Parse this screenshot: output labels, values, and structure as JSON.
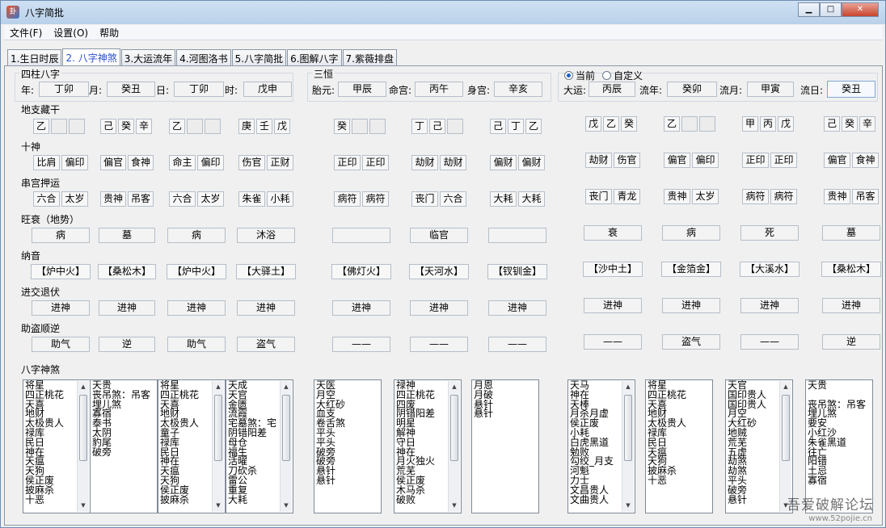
{
  "window": {
    "title": "八字简批",
    "min": "▁",
    "max": "□",
    "close": "✕"
  },
  "menu": [
    "文件(F)",
    "设置(O)",
    "帮助"
  ],
  "tabs": [
    "1.生日时辰",
    "2. 八字神煞",
    "3.大运流年",
    "4.河图洛书",
    "5.八字简批",
    "6.图解八字",
    "7.紫薇排盘"
  ],
  "bazi": {
    "title": "四柱八字",
    "year_label": "年:",
    "year": "丁卯",
    "month_label": "月:",
    "month": "癸丑",
    "day_label": "日:",
    "day": "丁卯",
    "hour_label": "时:",
    "hour": "戊申"
  },
  "sanyuan": {
    "title": "三恒",
    "taiyuan_label": "胎元:",
    "taiyuan": "甲辰",
    "minggong_label": "命宫:",
    "minggong": "丙午",
    "shengong_label": "身宫:",
    "shengong": "辛亥"
  },
  "current": {
    "opt_current": "当前",
    "opt_custom": "自定义",
    "dayun_label": "大运:",
    "dayun": "丙辰",
    "liunian_label": "流年:",
    "liunian": "癸卯",
    "liuyue_label": "流月:",
    "liuyue": "甲寅",
    "liuri_label": "流日:",
    "liuri": "癸丑"
  },
  "sections": {
    "dizhi": "地支藏干",
    "shishen": "十神",
    "chuangong": "串宫押运",
    "wangshuai": "旺衰（地势）",
    "nayin": "纳音",
    "jinjiao": "进交退伏",
    "zhudao": "助盗顺逆",
    "shensha": "八字神煞"
  },
  "columns": [
    {
      "canggan": [
        "乙",
        "",
        ""
      ],
      "shishen": [
        "比肩",
        "偏印"
      ],
      "chuan": [
        "六合",
        "太岁"
      ],
      "ws": "病",
      "nayin": "【炉中火】",
      "jj": "进神",
      "zd": "助气",
      "shensha": "将星\n四正桃花\n天喜\n地财\n太极贵人\n禄库\n民日\n神在\n天瘟\n天狗\n侯正废\n披麻杀\n十恶"
    },
    {
      "canggan": [
        "己",
        "癸",
        "辛"
      ],
      "shishen": [
        "偏官",
        "食神"
      ],
      "chuan": [
        "贵神",
        "吊客"
      ],
      "ws": "墓",
      "nayin": "【桑松木】",
      "jj": "进神",
      "zd": "逆",
      "shensha": "天贵\n丧吊煞：吊客\n埋儿煞\n寡宿\n泰书\n太阴\n豹尾\n破旁"
    },
    {
      "canggan": [
        "乙",
        "",
        ""
      ],
      "shishen": [
        "命主",
        "偏印"
      ],
      "chuan": [
        "六合",
        "太岁"
      ],
      "ws": "病",
      "nayin": "【炉中火】",
      "jj": "进神",
      "zd": "助气",
      "shensha": "将星\n四正桃花\n天喜\n地财\n太极贵人\n童子\n禄库\n民日\n神在\n天瘟\n天狗\n侯正废\n披麻杀"
    },
    {
      "canggan": [
        "庚",
        "壬",
        "戊"
      ],
      "shishen": [
        "伤官",
        "正财"
      ],
      "chuan": [
        "朱雀",
        "小耗"
      ],
      "ws": "沐浴",
      "nayin": "【大驿土】",
      "jj": "进神",
      "zd": "盗气",
      "shensha": "天成\n天官\n金匮\n流霞\n宅墓煞：宅\n阴错阳差\n母仓\n福生\n活曜\n刀砍杀\n雷公\n重复\n大耗"
    },
    {
      "canggan": [
        "癸",
        "",
        ""
      ],
      "shishen": [
        "正印",
        "正印"
      ],
      "chuan": [
        "病符",
        "病符"
      ],
      "ws": "",
      "nayin": "【佛灯火】",
      "jj": "进神",
      "zd": "——",
      "shensha": "天医\n月空\n大红砂\n血支\n卷舌煞\n平头\n平头\n破旁\n破旁\n悬针\n悬针"
    },
    {
      "canggan": [
        "丁",
        "己",
        ""
      ],
      "shishen": [
        "劫财",
        "劫财"
      ],
      "chuan": [
        "丧门",
        "六合"
      ],
      "ws": "临官",
      "nayin": "【天河水】",
      "jj": "进神",
      "zd": "——",
      "shensha": "禄神\n四正桃花\n四废\n阴错阳差\n明星\n解神\n守日\n神在\n月火独火\n荒芜\n侯正废\n木马杀\n破败"
    },
    {
      "canggan": [
        "己",
        "丁",
        "乙"
      ],
      "shishen": [
        "偏财",
        "偏财"
      ],
      "chuan": [
        "大耗",
        "大耗"
      ],
      "ws": "",
      "nayin": "【钗钏金】",
      "jj": "进神",
      "zd": "——",
      "shensha": "月恩\n月破\n悬针\n悬针"
    },
    {
      "canggan": [
        "戊",
        "乙",
        "癸"
      ],
      "shishen": [
        "劫财",
        "伤官"
      ],
      "chuan": [
        "丧门",
        "青龙"
      ],
      "ws": "衰",
      "nayin": "【沙中土】",
      "jj": "进神",
      "zd": "——",
      "shensha": "天马\n神在\n天棒\n月杀月虚\n侯正废\n小耗\n白虎黑道\n勉败\n勾绞_月支\n河魁\n力士\n文昌贵人\n文曲贵人"
    },
    {
      "canggan": [
        "乙",
        "",
        ""
      ],
      "shishen": [
        "偏官",
        "偏印"
      ],
      "chuan": [
        "贵神",
        "太岁"
      ],
      "ws": "病",
      "nayin": "【金箔金】",
      "jj": "进神",
      "zd": "盗气",
      "shensha": "将星\n四正桃花\n天喜\n地财\n太极贵人\n禄库\n民日\n天瘟\n天狗\n披麻杀\n十恶"
    },
    {
      "canggan": [
        "甲",
        "丙",
        "戊"
      ],
      "shishen": [
        "正印",
        "正印"
      ],
      "chuan": [
        "病符",
        "病符"
      ],
      "ws": "死",
      "nayin": "【大溪水】",
      "jj": "进神",
      "zd": "——",
      "shensha": "天官\n国印贵人\n国印贵人\n月空\n大红砂\n地贼\n荒芜\n五虚\n劫煞\n劫煞\n平头\n破旁\n悬针"
    },
    {
      "canggan": [
        "己",
        "癸",
        "辛"
      ],
      "shishen": [
        "偏官",
        "食神"
      ],
      "chuan": [
        "贵神",
        "吊客"
      ],
      "ws": "墓",
      "nayin": "【桑松木】",
      "jj": "进神",
      "zd": "逆",
      "shensha": "天贵\n\n丧吊煞：吊客\n埋儿煞\n要安\n小红沙\n朱雀黑道\n往亡\n阳错\n土忌\n寡宿"
    }
  ],
  "watermark": "吾爱破解论坛",
  "watermark_url": "www.52pojie.cn"
}
